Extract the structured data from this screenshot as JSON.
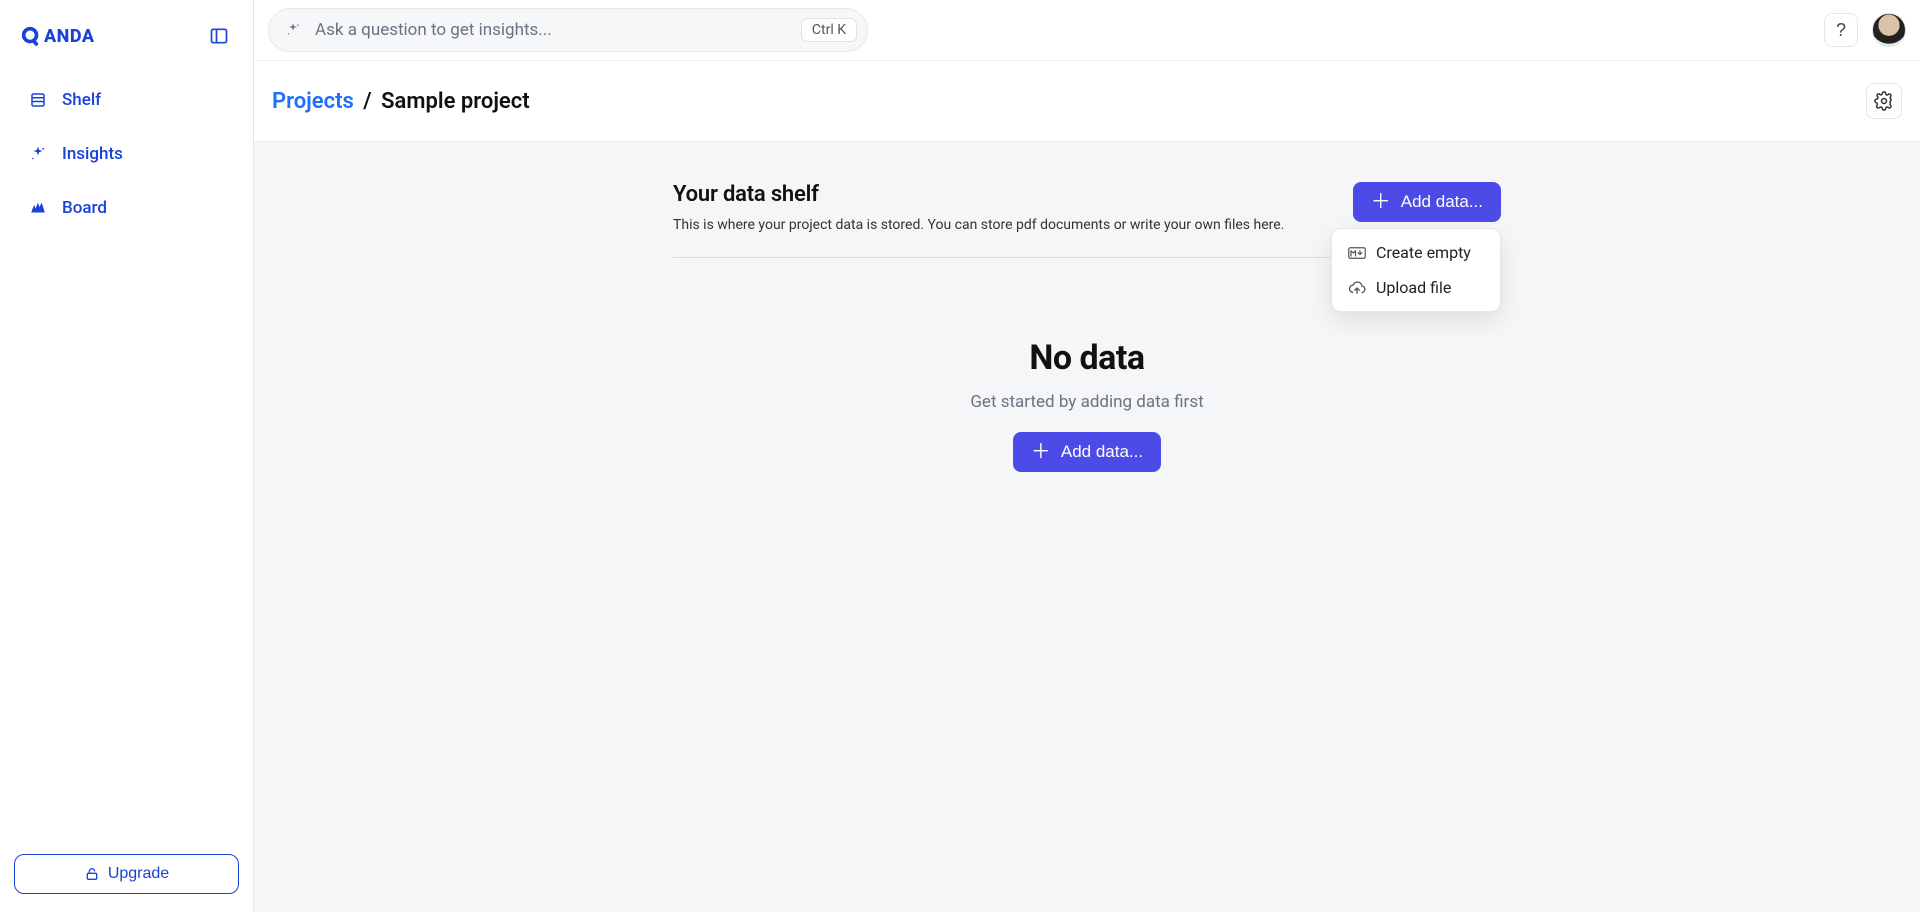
{
  "brand": {
    "name": "ANDA"
  },
  "sidebar": {
    "items": [
      {
        "label": "Shelf"
      },
      {
        "label": "Insights"
      },
      {
        "label": "Board"
      }
    ],
    "upgrade_label": "Upgrade"
  },
  "topbar": {
    "search_placeholder": "Ask a question to get insights...",
    "shortcut": "Ctrl K",
    "help_label": "?"
  },
  "breadcrumb": {
    "root": "Projects",
    "separator": "/",
    "current": "Sample project"
  },
  "shelf": {
    "heading": "Your data shelf",
    "subheading": "This is where your project data is stored. You can store pdf documents or write your own files here.",
    "add_button_label": "Add data...",
    "dropdown": [
      {
        "label": "Create empty"
      },
      {
        "label": "Upload file"
      }
    ]
  },
  "empty_state": {
    "title": "No data",
    "subtitle": "Get started by adding data first",
    "cta_label": "Add data..."
  }
}
